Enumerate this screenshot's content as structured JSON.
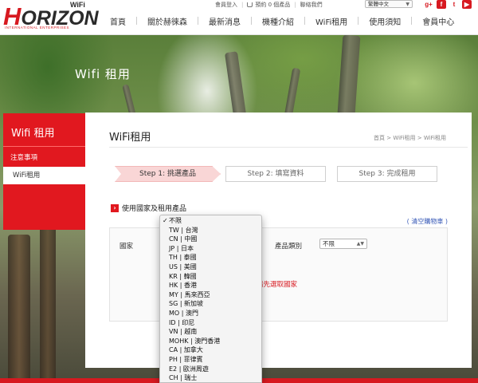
{
  "brand": {
    "logo_main": "ORIZON",
    "logo_h": "H",
    "logo_wifi": "WiFi",
    "logo_sub": "INTERNATIONAL ENTERPRISES",
    "accent_color": "#d71920"
  },
  "util_bar": {
    "login": "會員登入",
    "cart": "預約 0 個產品",
    "contact": "聯絡我們",
    "language": "繁體中文"
  },
  "social": [
    {
      "icon": "google-plus-icon",
      "glyph": "g+"
    },
    {
      "icon": "facebook-icon",
      "glyph": "f"
    },
    {
      "icon": "twitter-icon",
      "glyph": "t"
    },
    {
      "icon": "youtube-icon",
      "glyph": "▶"
    }
  ],
  "nav": [
    "首頁",
    "關於赫徠森",
    "最新消息",
    "機種介紹",
    "WiFi租用",
    "使用須知",
    "會員中心"
  ],
  "hero": {
    "title": "Wifi 租用"
  },
  "sidebar": {
    "title": "Wifi 租用",
    "items": [
      "注意事項",
      "WiFi租用"
    ]
  },
  "panel": {
    "title": "WiFi租用",
    "breadcrumb": "首頁 > WiFi租用 > WiFi租用"
  },
  "steps": [
    "Step 1: 挑選產品",
    "Step 2: 填寫資料",
    "Step 3: 完成租用"
  ],
  "section": {
    "heading": "使用國家及租用產品",
    "clear_cart": "( 清空購物車 )"
  },
  "form": {
    "country_label": "國家",
    "type_label": "產品類別",
    "type_value": "不限",
    "warning": "請先選取國家"
  },
  "dropdown": {
    "selected": "不限",
    "options": [
      "不限",
      "TW | 台灣",
      "CN | 中國",
      "JP | 日本",
      "TH | 泰國",
      "US | 美國",
      "KR | 韓國",
      "HK | 香港",
      "MY | 馬來西亞",
      "SG | 新加坡",
      "MO | 澳門",
      "ID | 印尼",
      "VN | 越南",
      "MOHK | 澳門香港",
      "CA | 加拿大",
      "PH | 菲律賓",
      "E2 | 歐洲周遊",
      "CH | 瑞士"
    ]
  }
}
